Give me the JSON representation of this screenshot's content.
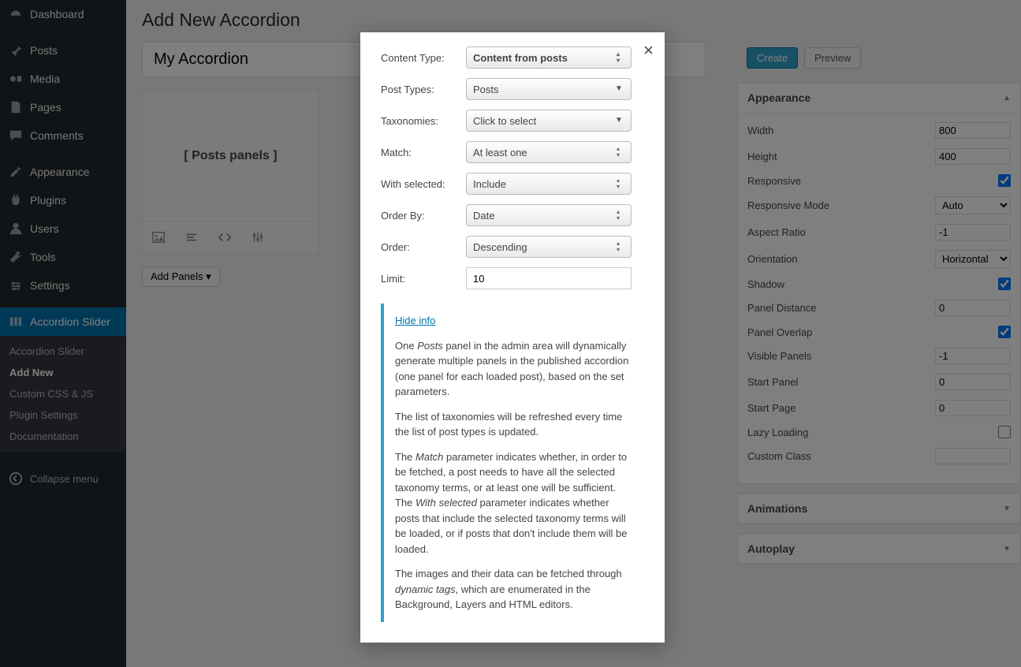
{
  "sidebar": {
    "items": [
      {
        "label": "Dashboard",
        "icon": "dashboard-icon"
      },
      {
        "label": "Posts",
        "icon": "pin-icon"
      },
      {
        "label": "Media",
        "icon": "media-icon"
      },
      {
        "label": "Pages",
        "icon": "pages-icon"
      },
      {
        "label": "Comments",
        "icon": "comments-icon"
      },
      {
        "label": "Appearance",
        "icon": "appearance-icon"
      },
      {
        "label": "Plugins",
        "icon": "plugins-icon"
      },
      {
        "label": "Users",
        "icon": "users-icon"
      },
      {
        "label": "Tools",
        "icon": "tools-icon"
      },
      {
        "label": "Settings",
        "icon": "settings-icon"
      },
      {
        "label": "Accordion Slider",
        "icon": "accordion-icon"
      }
    ],
    "sub": [
      "Accordion Slider",
      "Add New",
      "Custom CSS & JS",
      "Plugin Settings",
      "Documentation"
    ],
    "collapse": "Collapse menu"
  },
  "page": {
    "title": "Add New Accordion",
    "accordion_title": "My Accordion",
    "panel_placeholder": "[ Posts panels ]",
    "add_panels": "Add Panels ▾"
  },
  "buttons": {
    "create": "Create",
    "preview": "Preview"
  },
  "appearance": {
    "heading": "Appearance",
    "fields": {
      "width": {
        "label": "Width",
        "value": "800"
      },
      "height": {
        "label": "Height",
        "value": "400"
      },
      "responsive": {
        "label": "Responsive",
        "checked": true
      },
      "responsive_mode": {
        "label": "Responsive Mode",
        "value": "Auto"
      },
      "aspect_ratio": {
        "label": "Aspect Ratio",
        "value": "-1"
      },
      "orientation": {
        "label": "Orientation",
        "value": "Horizontal"
      },
      "shadow": {
        "label": "Shadow",
        "checked": true
      },
      "panel_distance": {
        "label": "Panel Distance",
        "value": "0"
      },
      "panel_overlap": {
        "label": "Panel Overlap",
        "checked": true
      },
      "visible_panels": {
        "label": "Visible Panels",
        "value": "-1"
      },
      "start_panel": {
        "label": "Start Panel",
        "value": "0"
      },
      "start_page": {
        "label": "Start Page",
        "value": "0"
      },
      "lazy_loading": {
        "label": "Lazy Loading",
        "checked": false
      },
      "custom_class": {
        "label": "Custom Class",
        "value": ""
      }
    }
  },
  "sections": {
    "animations": "Animations",
    "autoplay": "Autoplay"
  },
  "modal": {
    "fields": {
      "content_type": {
        "label": "Content Type:",
        "value": "Content from posts"
      },
      "post_types": {
        "label": "Post Types:",
        "value": "Posts"
      },
      "taxonomies": {
        "label": "Taxonomies:",
        "value": "Click to select"
      },
      "match": {
        "label": "Match:",
        "value": "At least one"
      },
      "with_selected": {
        "label": "With selected:",
        "value": "Include"
      },
      "order_by": {
        "label": "Order By:",
        "value": "Date"
      },
      "order": {
        "label": "Order:",
        "value": "Descending"
      },
      "limit": {
        "label": "Limit:",
        "value": "10"
      }
    },
    "info": {
      "hide": "Hide info",
      "p1a": "One ",
      "p1em": "Posts",
      "p1b": " panel in the admin area will dynamically generate multiple panels in the published accordion (one panel for each loaded post), based on the set parameters.",
      "p2": "The list of taxonomies will be refreshed every time the list of post types is updated.",
      "p3a": "The ",
      "p3em1": "Match",
      "p3b": " parameter indicates whether, in order to be fetched, a post needs to have all the selected taxonomy terms, or at least one will be sufficient. The ",
      "p3em2": "With selected",
      "p3c": " parameter indicates whether posts that include the selected taxonomy terms will be loaded, or if posts that don't include them will be loaded.",
      "p4a": "The images and their data can be fetched through ",
      "p4em": "dynamic tags",
      "p4b": ", which are enumerated in the Background, Layers and HTML editors."
    }
  }
}
